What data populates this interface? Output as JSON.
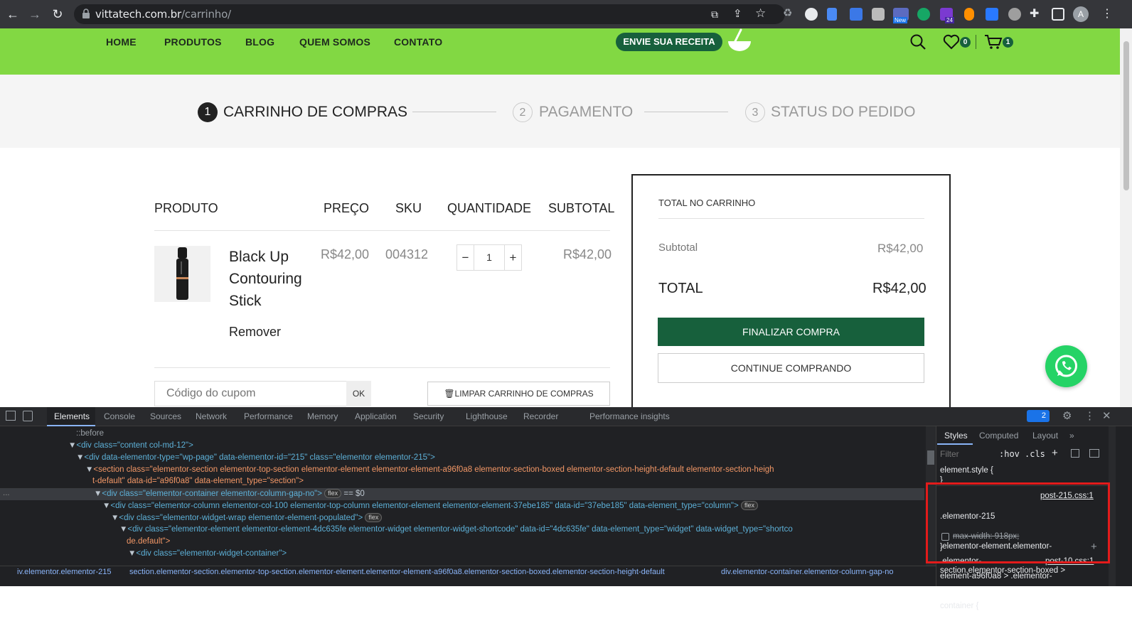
{
  "browser": {
    "url_domain": "vittatech.com.br",
    "url_path": "/carrinho/",
    "profile_initial": "A",
    "new_badge": "New",
    "count_badge": "24"
  },
  "site": {
    "nav": [
      "HOME",
      "PRODUTOS",
      "BLOG",
      "QUEM SOMOS",
      "CONTATO"
    ],
    "receita_button": "ENVIE SUA RECEITA",
    "wishlist_count": "0",
    "cart_count": "1"
  },
  "steps": [
    {
      "num": "1",
      "label": "CARRINHO DE COMPRAS"
    },
    {
      "num": "2",
      "label": "PAGAMENTO"
    },
    {
      "num": "3",
      "label": "STATUS DO PEDIDO"
    }
  ],
  "cart": {
    "headers": {
      "produto": "PRODUTO",
      "preco": "PREÇO",
      "sku": "SKU",
      "quantidade": "QUANTIDADE",
      "subtotal": "SUBTOTAL"
    },
    "item": {
      "name_lines": [
        "Black Up",
        "Contouring",
        "Stick"
      ],
      "remove": "Remover",
      "price": "R$42,00",
      "sku": "004312",
      "qty_minus": "−",
      "qty": "1",
      "qty_plus": "+",
      "subtotal": "R$42,00"
    },
    "coupon_placeholder": "Código do cupom",
    "coupon_ok": "OK",
    "clear_cart": "LIMPAR CARRINHO DE COMPRAS"
  },
  "totals": {
    "title": "TOTAL NO CARRINHO",
    "subtotal_label": "Subtotal",
    "subtotal_value": "R$42,00",
    "total_label": "TOTAL",
    "total_value": "R$42,00",
    "checkout": "FINALIZAR COMPRA",
    "continue": "CONTINUE COMPRANDO"
  },
  "devtools": {
    "tabs": [
      "Elements",
      "Console",
      "Sources",
      "Network",
      "Performance",
      "Memory",
      "Application",
      "Security",
      "Lighthouse",
      "Recorder",
      "Performance insights"
    ],
    "issues_count": "2",
    "style_tabs": [
      "Styles",
      "Computed",
      "Layout"
    ],
    "filter_placeholder": "Filter",
    "hov": ":hov",
    "cls": ".cls",
    "dom_lines": [
      "::before",
      "<div class=\"content col-md-12\">",
      "<div data-elementor-type=\"wp-page\" data-elementor-id=\"215\" class=\"elementor elementor-215\">",
      "<section class=\"elementor-section elementor-top-section elementor-element elementor-element-a96f0a8 elementor-section-boxed elementor-section-height-default elementor-section-heigh",
      "t-default\" data-id=\"a96f0a8\" data-element_type=\"section\">",
      "<div class=\"elementor-container elementor-column-gap-no\">",
      "<div class=\"elementor-column elementor-col-100 elementor-top-column elementor-element elementor-element-37ebe185\" data-id=\"37ebe185\" data-element_type=\"column\">",
      "<div class=\"elementor-widget-wrap elementor-element-populated\">",
      "<div class=\"elementor-element elementor-element-4dc635fe elementor-widget elementor-widget-shortcode\" data-id=\"4dc635fe\" data-element_type=\"widget\" data-widget_type=\"shortco",
      "de.default\">",
      "<div class=\"elementor-widget-container\">"
    ],
    "flex_chip": "flex",
    "eq0": "== $0",
    "styles": {
      "element_style": "element.style {",
      "close_brace": "}",
      "rule_selector_lines": [
        ".elementor-215",
        ".elementor-element.elementor-",
        "element-a96f0a8 > .elementor-",
        "container {"
      ],
      "rule_source": "post-215.css:1",
      "rule_prop": "max-width: 918px;",
      "next_selector": ".elementor-",
      "next_source": "post-10.css:1",
      "next_selector2": "section.elementor-section-boxed >"
    },
    "breadcrumb": [
      "iv.elementor.elementor-215",
      "section.elementor-section.elementor-top-section.elementor-element.elementor-element-a96f0a8.elementor-section-boxed.elementor-section-height-default",
      "div.elementor-container.elementor-column-gap-no"
    ]
  }
}
